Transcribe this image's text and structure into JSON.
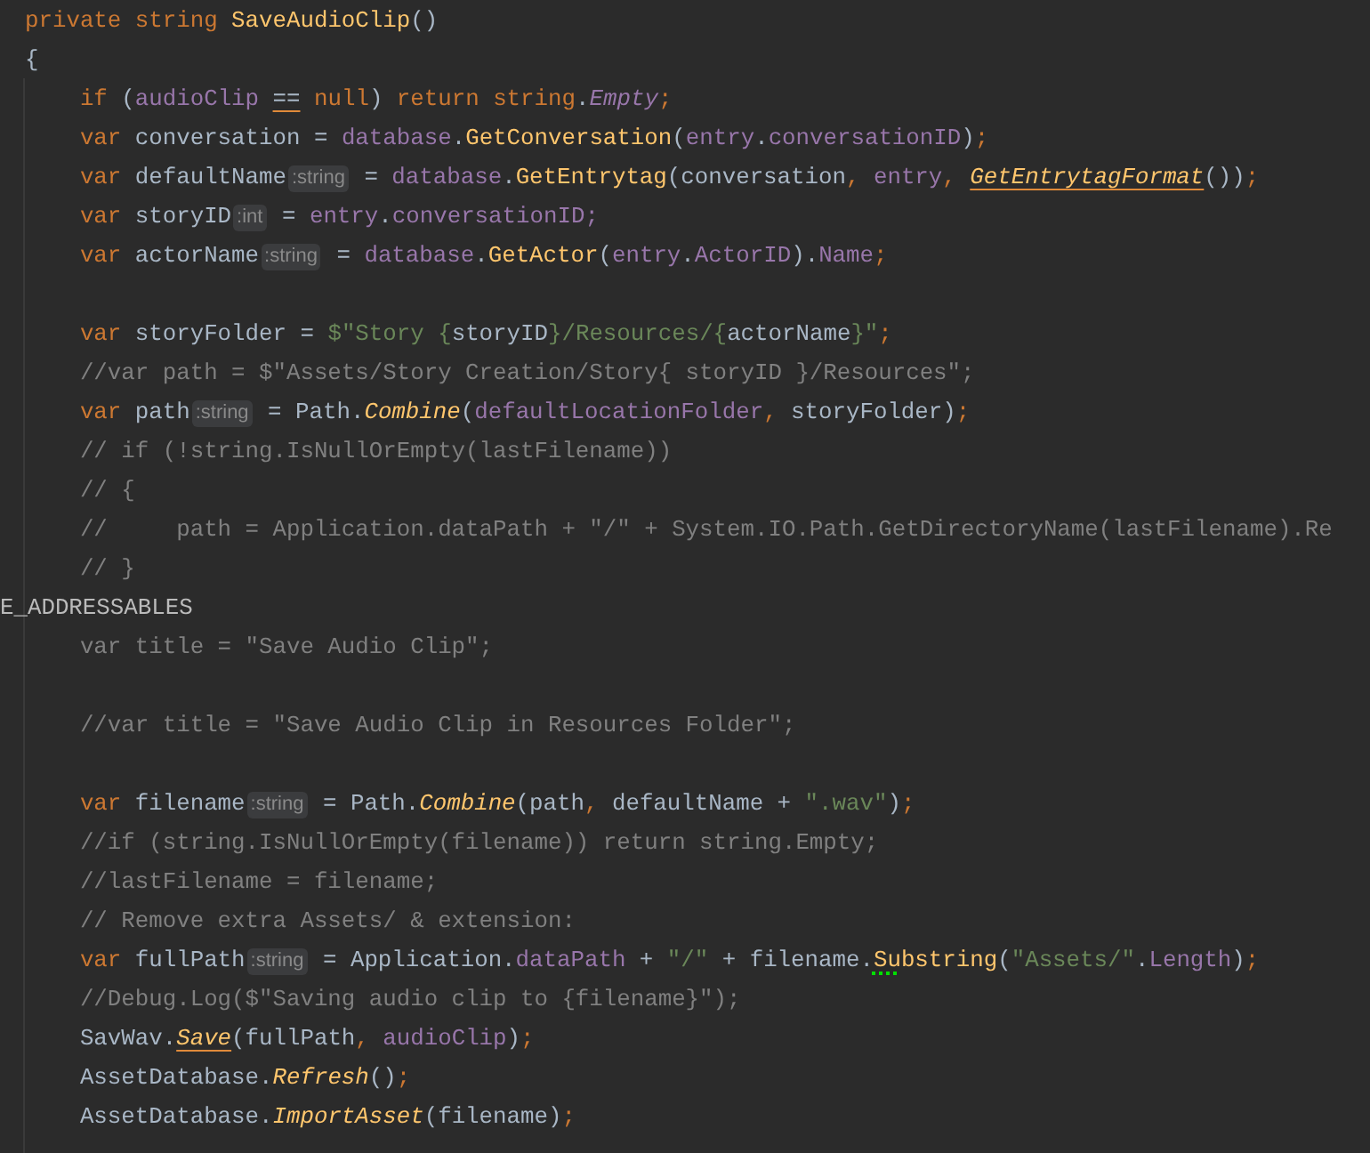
{
  "editor": {
    "lines": [
      {
        "kind": "code",
        "tokens": [
          {
            "kind": "kw",
            "t": "private string "
          },
          {
            "kind": "fn",
            "t": "SaveAudioClip"
          },
          {
            "kind": "txt",
            "t": "()"
          }
        ]
      },
      {
        "kind": "code",
        "tokens": [
          {
            "kind": "txt",
            "t": "{"
          }
        ]
      },
      {
        "kind": "code",
        "tokens": [
          {
            "kind": "kw",
            "t": "    if "
          },
          {
            "kind": "txt",
            "t": "("
          },
          {
            "kind": "fld",
            "t": "audioClip "
          },
          {
            "kind": "txt",
            "t": "==",
            "underlined": true
          },
          {
            "kind": "kw",
            "t": " null"
          },
          {
            "kind": "txt",
            "t": ") "
          },
          {
            "kind": "kw",
            "t": "return string"
          },
          {
            "kind": "txt",
            "t": "."
          },
          {
            "kind": "fldi",
            "t": "Empty"
          },
          {
            "kind": "punc",
            "t": ";"
          }
        ]
      },
      {
        "kind": "code",
        "tokens": [
          {
            "kind": "kw",
            "t": "    var "
          },
          {
            "kind": "txt",
            "t": "conversation = "
          },
          {
            "kind": "fld",
            "t": "database"
          },
          {
            "kind": "txt",
            "t": "."
          },
          {
            "kind": "fn",
            "t": "GetConversation"
          },
          {
            "kind": "txt",
            "t": "("
          },
          {
            "kind": "fld",
            "t": "entry"
          },
          {
            "kind": "txt",
            "t": "."
          },
          {
            "kind": "fld",
            "t": "conversationID"
          },
          {
            "kind": "txt",
            "t": ")"
          },
          {
            "kind": "punc",
            "t": ";"
          }
        ]
      },
      {
        "kind": "code",
        "tokens": [
          {
            "kind": "kw",
            "t": "    var "
          },
          {
            "kind": "txt",
            "t": "defaultName"
          },
          {
            "kind": "hint",
            "t": ":string"
          },
          {
            "kind": "txt",
            "t": " = "
          },
          {
            "kind": "fld",
            "t": "database"
          },
          {
            "kind": "txt",
            "t": "."
          },
          {
            "kind": "fn",
            "t": "GetEntrytag"
          },
          {
            "kind": "txt",
            "t": "(conversation"
          },
          {
            "kind": "punc",
            "t": ", "
          },
          {
            "kind": "fld",
            "t": "entry"
          },
          {
            "kind": "punc",
            "t": ", "
          },
          {
            "kind": "fni",
            "t": "GetEntrytagFormat",
            "underlined": true
          },
          {
            "kind": "txt",
            "t": "())"
          },
          {
            "kind": "punc",
            "t": ";"
          }
        ]
      },
      {
        "kind": "code",
        "tokens": [
          {
            "kind": "kw",
            "t": "    var "
          },
          {
            "kind": "txt",
            "t": "storyID"
          },
          {
            "kind": "hint",
            "t": ":int"
          },
          {
            "kind": "txt",
            "t": " = "
          },
          {
            "kind": "fld",
            "t": "entry"
          },
          {
            "kind": "txt",
            "t": "."
          },
          {
            "kind": "fld",
            "t": "conversationID;"
          }
        ]
      },
      {
        "kind": "code",
        "tokens": [
          {
            "kind": "kw",
            "t": "    var "
          },
          {
            "kind": "txt",
            "t": "actorName"
          },
          {
            "kind": "hint",
            "t": ":string"
          },
          {
            "kind": "txt",
            "t": " = "
          },
          {
            "kind": "fld",
            "t": "database"
          },
          {
            "kind": "txt",
            "t": "."
          },
          {
            "kind": "fn",
            "t": "GetActor"
          },
          {
            "kind": "txt",
            "t": "("
          },
          {
            "kind": "fld",
            "t": "entry"
          },
          {
            "kind": "txt",
            "t": "."
          },
          {
            "kind": "fld",
            "t": "ActorID"
          },
          {
            "kind": "txt",
            "t": ")."
          },
          {
            "kind": "fld",
            "t": "Name"
          },
          {
            "kind": "punc",
            "t": ";"
          }
        ]
      },
      {
        "kind": "blank"
      },
      {
        "kind": "code",
        "tokens": [
          {
            "kind": "kw",
            "t": "    var "
          },
          {
            "kind": "txt",
            "t": "storyFolder = "
          },
          {
            "kind": "str",
            "t": "$\"Story {"
          },
          {
            "kind": "txt",
            "t": "storyID"
          },
          {
            "kind": "str",
            "t": "}/Resources/{"
          },
          {
            "kind": "txt",
            "t": "actorName"
          },
          {
            "kind": "str",
            "t": "}\""
          },
          {
            "kind": "punc",
            "t": ";"
          }
        ]
      },
      {
        "kind": "code",
        "tokens": [
          {
            "kind": "cm",
            "t": "    //var path = $\"Assets/Story Creation/Story{ storyID }/Resources\";"
          }
        ]
      },
      {
        "kind": "code",
        "tokens": [
          {
            "kind": "kw",
            "t": "    var "
          },
          {
            "kind": "txt",
            "t": "path"
          },
          {
            "kind": "hint",
            "t": ":string"
          },
          {
            "kind": "txt",
            "t": " = Path."
          },
          {
            "kind": "fni",
            "t": "Combine"
          },
          {
            "kind": "txt",
            "t": "("
          },
          {
            "kind": "fld",
            "t": "defaultLocationFolder"
          },
          {
            "kind": "punc",
            "t": ", "
          },
          {
            "kind": "txt",
            "t": "storyFolder)"
          },
          {
            "kind": "punc",
            "t": ";"
          }
        ]
      },
      {
        "kind": "code",
        "tokens": [
          {
            "kind": "cm",
            "t": "    // if (!string.IsNullOrEmpty(lastFilename))"
          }
        ]
      },
      {
        "kind": "code",
        "tokens": [
          {
            "kind": "cm",
            "t": "    // {"
          }
        ]
      },
      {
        "kind": "code",
        "tokens": [
          {
            "kind": "cm",
            "t": "    //     path = Application.dataPath + \"/\" + System.IO.Path.GetDirectoryName(lastFilename).Re"
          }
        ]
      },
      {
        "kind": "code",
        "tokens": [
          {
            "kind": "cm",
            "t": "    // }"
          }
        ]
      },
      {
        "kind": "directive",
        "tokens": [
          {
            "kind": "dir",
            "t": "E_ADDRESSABLES"
          }
        ]
      },
      {
        "kind": "code",
        "tokens": [
          {
            "kind": "cm",
            "t": "    var title = \"Save Audio Clip\";"
          }
        ]
      },
      {
        "kind": "blank"
      },
      {
        "kind": "code",
        "tokens": [
          {
            "kind": "cm",
            "t": "    //var title = \"Save Audio Clip in Resources Folder\";"
          }
        ]
      },
      {
        "kind": "blank"
      },
      {
        "kind": "code",
        "tokens": [
          {
            "kind": "kw",
            "t": "    var "
          },
          {
            "kind": "txt",
            "t": "filename"
          },
          {
            "kind": "hint",
            "t": ":string"
          },
          {
            "kind": "txt",
            "t": " = Path."
          },
          {
            "kind": "fni",
            "t": "Combine"
          },
          {
            "kind": "txt",
            "t": "(path"
          },
          {
            "kind": "punc",
            "t": ", "
          },
          {
            "kind": "txt",
            "t": "defaultName + "
          },
          {
            "kind": "str",
            "t": "\".wav\""
          },
          {
            "kind": "txt",
            "t": ")"
          },
          {
            "kind": "punc",
            "t": ";"
          }
        ]
      },
      {
        "kind": "code",
        "tokens": [
          {
            "kind": "cm",
            "t": "    //if (string.IsNullOrEmpty(filename)) return string.Empty;"
          }
        ]
      },
      {
        "kind": "code",
        "tokens": [
          {
            "kind": "cm",
            "t": "    //lastFilename = filename;"
          }
        ]
      },
      {
        "kind": "code",
        "tokens": [
          {
            "kind": "cm",
            "t": "    // Remove extra Assets/ & extension:"
          }
        ]
      },
      {
        "kind": "code",
        "tokens": [
          {
            "kind": "kw",
            "t": "    var "
          },
          {
            "kind": "txt",
            "t": "fullPath"
          },
          {
            "kind": "hint",
            "t": ":string"
          },
          {
            "kind": "txt",
            "t": " = Application."
          },
          {
            "kind": "fld",
            "t": "dataPath"
          },
          {
            "kind": "txt",
            "t": " + "
          },
          {
            "kind": "str",
            "t": "\"/\""
          },
          {
            "kind": "txt",
            "t": " + filename."
          },
          {
            "kind": "fn",
            "t": "Su",
            "squiggle": true
          },
          {
            "kind": "fn",
            "t": "bstring"
          },
          {
            "kind": "txt",
            "t": "("
          },
          {
            "kind": "str",
            "t": "\"Assets/\""
          },
          {
            "kind": "txt",
            "t": "."
          },
          {
            "kind": "fld",
            "t": "Length"
          },
          {
            "kind": "txt",
            "t": ")"
          },
          {
            "kind": "punc",
            "t": ";"
          }
        ]
      },
      {
        "kind": "code",
        "tokens": [
          {
            "kind": "cm",
            "t": "    //Debug.Log($\"Saving audio clip to {filename}\");"
          }
        ]
      },
      {
        "kind": "code",
        "tokens": [
          {
            "kind": "txt",
            "t": "    SavWav."
          },
          {
            "kind": "fni",
            "t": "Save",
            "underlined": true
          },
          {
            "kind": "txt",
            "t": "(fullPath"
          },
          {
            "kind": "punc",
            "t": ", "
          },
          {
            "kind": "fld",
            "t": "audioClip"
          },
          {
            "kind": "txt",
            "t": ")"
          },
          {
            "kind": "punc",
            "t": ";"
          }
        ]
      },
      {
        "kind": "code",
        "tokens": [
          {
            "kind": "txt",
            "t": "    AssetDatabase."
          },
          {
            "kind": "fni",
            "t": "Refresh"
          },
          {
            "kind": "txt",
            "t": "()"
          },
          {
            "kind": "punc",
            "t": ";"
          }
        ]
      },
      {
        "kind": "code",
        "tokens": [
          {
            "kind": "txt",
            "t": "    AssetDatabase."
          },
          {
            "kind": "fni",
            "t": "ImportAsset"
          },
          {
            "kind": "txt",
            "t": "(filename)"
          },
          {
            "kind": "punc",
            "t": ";"
          }
        ]
      }
    ]
  }
}
